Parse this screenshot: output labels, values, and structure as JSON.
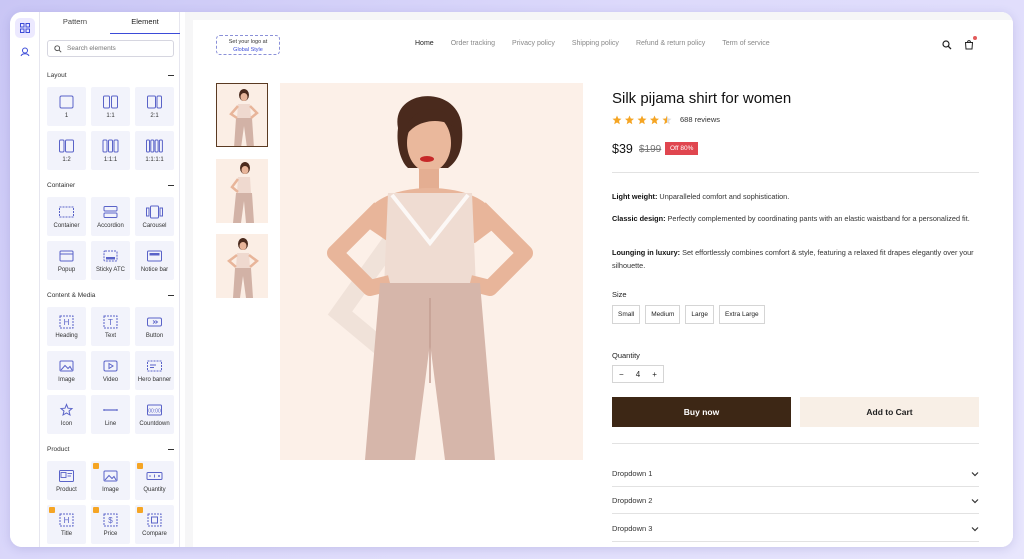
{
  "panel": {
    "tabs": [
      "Pattern",
      "Element"
    ],
    "search_placeholder": "Search elements",
    "sections": {
      "layout": {
        "title": "Layout",
        "items": [
          "1",
          "1:1",
          "2:1",
          "1:2",
          "1:1:1",
          "1:1:1:1"
        ]
      },
      "container": {
        "title": "Container",
        "items": [
          "Container",
          "Accordion",
          "Carousel",
          "Popup",
          "Sticky ATC",
          "Notice bar"
        ]
      },
      "content": {
        "title": "Content & Media",
        "items": [
          "Heading",
          "Text",
          "Button",
          "Image",
          "Video",
          "Hero banner",
          "Icon",
          "Line",
          "Countdown"
        ]
      },
      "product": {
        "title": "Product",
        "items": [
          "Product",
          "Image",
          "Quantity",
          "Title",
          "Price",
          "Compare"
        ]
      }
    }
  },
  "header": {
    "logo_line1": "Set your logo at",
    "logo_line2": "Global Style",
    "nav": [
      "Home",
      "Order tracking",
      "Privacy policy",
      "Shipping policy",
      "Refund & return policy",
      "Term of service"
    ]
  },
  "product": {
    "title": "Silk pijama shirt for women",
    "rating": 4.5,
    "reviews": "688 reviews",
    "price": "$39",
    "old_price": "$199",
    "discount": "Off 80%",
    "desc": [
      {
        "label": "Light weight:",
        "text": " Unparalleled comfort and sophistication."
      },
      {
        "label": "Classic design:",
        "text": " Perfectly complemented by coordinating pants with an elastic waistband for a personalized fit."
      },
      {
        "label": "Lounging in luxury:",
        "text": " Set effortlessly combines comfort & style, featuring a relaxed fit drapes elegantly over your silhouette."
      }
    ],
    "size_label": "Size",
    "sizes": [
      "Small",
      "Medium",
      "Large",
      "Extra Large"
    ],
    "quantity_label": "Quantity",
    "quantity_minus": "−",
    "quantity_value": "4",
    "quantity_plus": "+",
    "buy_now": "Buy now",
    "add_to_cart": "Add to Cart",
    "dropdowns": [
      "Dropdown 1",
      "Dropdown 2",
      "Dropdown 3"
    ]
  },
  "colors": {
    "accent": "#3b4bd8",
    "buy_bg": "#3d2715",
    "cart_bg": "#f8efe6",
    "discount": "#e0464f",
    "star": "#f5a524"
  },
  "icons": [
    "elements-icon",
    "layers-icon",
    "search-icon",
    "bag-icon",
    "star-icon",
    "chevron-down-icon"
  ]
}
